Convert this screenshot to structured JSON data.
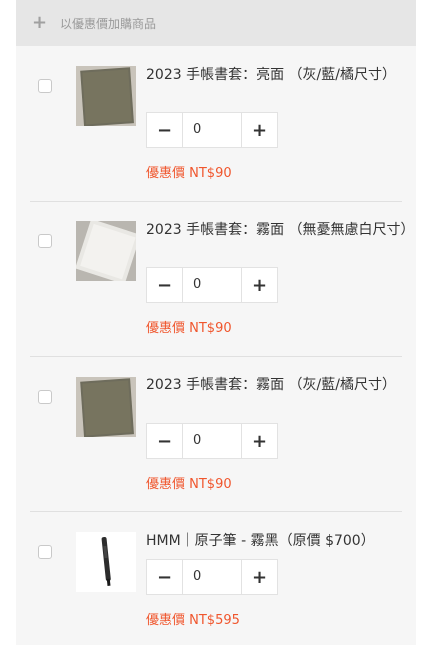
{
  "header": {
    "icon": "plus-icon",
    "title": "以優惠價加購商品"
  },
  "colors": {
    "price": "#f0562d",
    "header_bg": "#e6e6e6",
    "panel_bg": "#f6f6f6"
  },
  "items": [
    {
      "name": "2023 手帳書套：亮面 （灰/藍/橘尺寸）",
      "quantity": "0",
      "price": "優惠價 NT$90",
      "image": "gray-notebook-cover"
    },
    {
      "name": "2023 手帳書套：霧面 （無憂無慮白尺寸）",
      "quantity": "0",
      "price": "優惠價 NT$90",
      "image": "white-notebook-cover"
    },
    {
      "name": "2023 手帳書套：霧面 （灰/藍/橘尺寸）",
      "quantity": "0",
      "price": "優惠價 NT$90",
      "image": "gray-notebook-cover"
    },
    {
      "name": "HMM｜原子筆 - 霧黑（原價 $700）",
      "quantity": "0",
      "price": "優惠價 NT$595",
      "image": "black-ballpoint-pen"
    }
  ],
  "controls": {
    "minus": "−",
    "plus": "+"
  }
}
